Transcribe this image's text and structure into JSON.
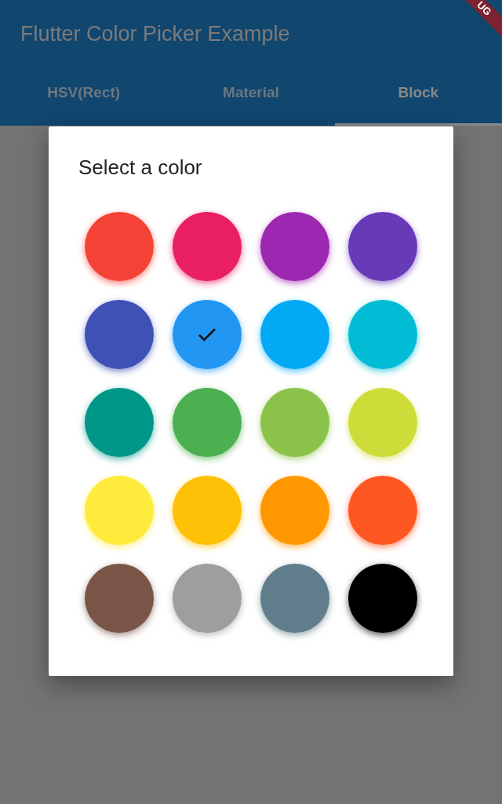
{
  "app_bar": {
    "title": "Flutter Color Picker Example",
    "debug_banner": "UG"
  },
  "tabs": [
    {
      "label": "HSV(Rect)",
      "selected": false
    },
    {
      "label": "Material",
      "selected": false
    },
    {
      "label": "Block",
      "selected": true
    }
  ],
  "dialog": {
    "title": "Select a color",
    "colors": [
      {
        "color": "#f44336",
        "selected": false
      },
      {
        "color": "#e91e63",
        "selected": false
      },
      {
        "color": "#9c27b0",
        "selected": false
      },
      {
        "color": "#673ab7",
        "selected": false
      },
      {
        "color": "#3f51b5",
        "selected": false
      },
      {
        "color": "#2196f3",
        "selected": true
      },
      {
        "color": "#03a9f4",
        "selected": false
      },
      {
        "color": "#00bcd4",
        "selected": false
      },
      {
        "color": "#009688",
        "selected": false
      },
      {
        "color": "#4caf50",
        "selected": false
      },
      {
        "color": "#8bc34a",
        "selected": false
      },
      {
        "color": "#cddc39",
        "selected": false
      },
      {
        "color": "#ffeb3b",
        "selected": false
      },
      {
        "color": "#ffc107",
        "selected": false
      },
      {
        "color": "#ff9800",
        "selected": false
      },
      {
        "color": "#ff5722",
        "selected": false
      },
      {
        "color": "#795548",
        "selected": false
      },
      {
        "color": "#9e9e9e",
        "selected": false
      },
      {
        "color": "#607d8b",
        "selected": false
      },
      {
        "color": "#000000",
        "selected": false
      }
    ]
  }
}
